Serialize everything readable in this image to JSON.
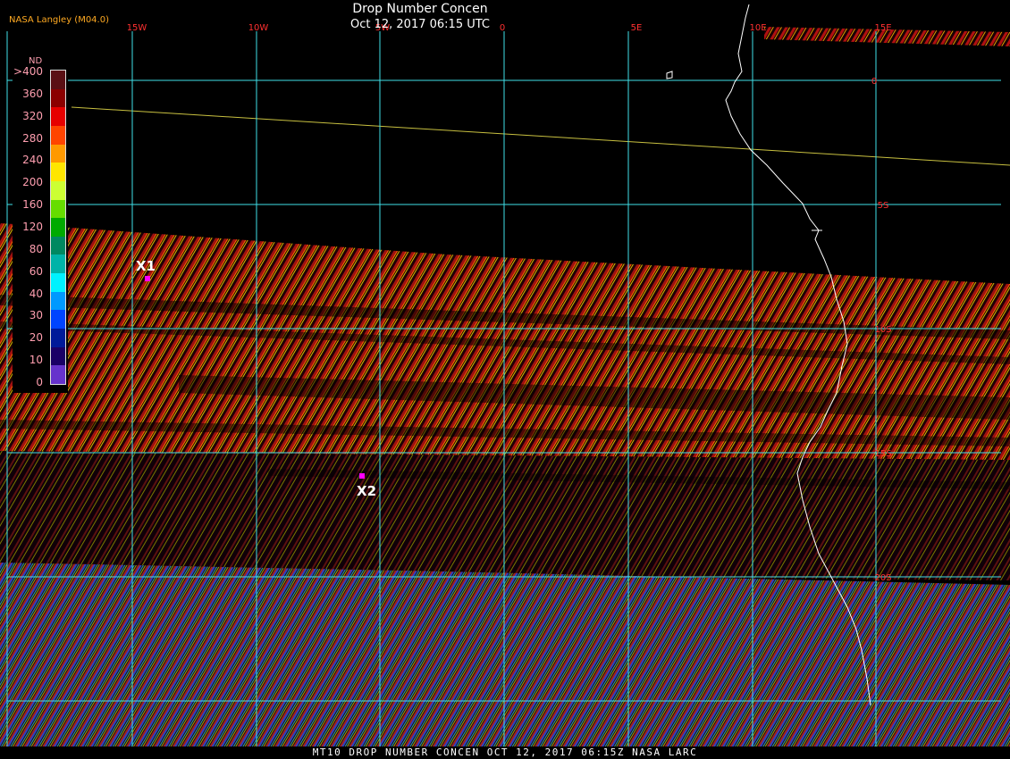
{
  "header": {
    "title": "Drop Number Concen",
    "timestamp": "Oct 12, 2017 06:15 UTC",
    "credit": "NASA Langley (M04.0)"
  },
  "footer": {
    "text": "MT10  DROP NUMBER CONCEN   OCT 12, 2017 06:15Z   NASA LARC"
  },
  "legend": {
    "unit": "ND",
    "labels": [
      ">400",
      "360",
      "320",
      "280",
      "240",
      "200",
      "160",
      "120",
      "80",
      "60",
      "40",
      "30",
      "20",
      "10",
      "0"
    ],
    "colors": [
      "#5a0f14",
      "#8b0000",
      "#e60000",
      "#ff4400",
      "#ff9900",
      "#ffe600",
      "#ccff33",
      "#66dd00",
      "#00aa00",
      "#008860",
      "#00b3a8",
      "#00f2ff",
      "#0099ff",
      "#0044ff",
      "#001a99",
      "#1a0066",
      "#6633cc"
    ]
  },
  "grid": {
    "longitude_labels": [
      "15W",
      "10W",
      "5W",
      "0",
      "5E",
      "10E",
      "15E"
    ],
    "latitude_labels": [
      "0",
      "5S",
      "10S",
      "15S",
      "20S"
    ],
    "line_color": "#40e0e8",
    "label_color": "#ff3030"
  },
  "markers": [
    {
      "label": "X1",
      "color": "#ff00ff"
    },
    {
      "label": "X2",
      "color": "#ff00ff"
    }
  ],
  "colors": {
    "background": "#000000",
    "coastline": "#ffffff"
  }
}
